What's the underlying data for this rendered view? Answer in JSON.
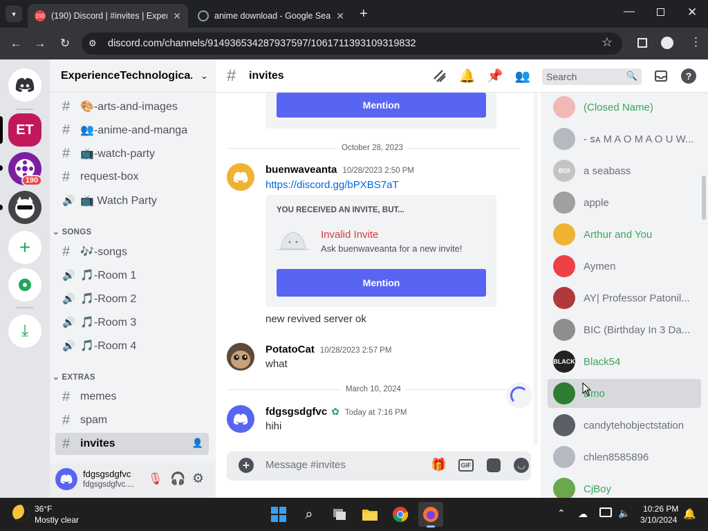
{
  "browser": {
    "tabs": [
      {
        "title": "(190) Discord | #invites | Experie",
        "badge": "190"
      },
      {
        "title": "anime download - Google Sear"
      }
    ],
    "url": "discord.com/channels/914936534287937597/1061711393109319832"
  },
  "server": {
    "name": "ExperienceTechnologica...",
    "guild_badge": "190",
    "et_label": "ET"
  },
  "channels": {
    "top": [
      {
        "prefix": "#",
        "label": "🎨-arts-and-images"
      },
      {
        "prefix": "#",
        "label": "👥-anime-and-manga"
      },
      {
        "prefix": "#",
        "label": "📺-watch-party"
      },
      {
        "prefix": "#",
        "label": "request-box"
      },
      {
        "prefix": "spk",
        "label": "📺 Watch Party"
      }
    ],
    "songs_category": "SONGS",
    "songs": [
      {
        "prefix": "#",
        "label": "🎶-songs"
      },
      {
        "prefix": "spk",
        "label": "🎵-Room 1"
      },
      {
        "prefix": "spk",
        "label": "🎵-Room 2"
      },
      {
        "prefix": "spk",
        "label": "🎵-Room 3"
      },
      {
        "prefix": "spk",
        "label": "🎵-Room 4"
      }
    ],
    "extras_category": "EXTRAS",
    "extras": [
      {
        "prefix": "#",
        "label": "memes"
      },
      {
        "prefix": "#",
        "label": "spam"
      },
      {
        "prefix": "#",
        "label": "invites"
      }
    ]
  },
  "user": {
    "name": "fdgsgsdgfvc",
    "tag": "fdgsgsdgfvc...."
  },
  "header": {
    "channel": "invites",
    "search_placeholder": "Search"
  },
  "chat": {
    "mention_label": "Mention",
    "date1": "October 28, 2023",
    "msg1": {
      "author": "buenwaveanta",
      "time": "10/28/2023 2:50 PM",
      "link": "https://discord.gg/bPXBS7aT"
    },
    "invite": {
      "heading": "YOU RECEIVED AN INVITE, BUT...",
      "title": "Invalid Invite",
      "sub": "Ask buenwaveanta for a new invite!"
    },
    "msg1b": "new revived server ok",
    "msg2": {
      "author": "PotatoCat",
      "time": "10/28/2023 2:57 PM",
      "text": "what"
    },
    "date2": "March 10, 2024",
    "msg3": {
      "author": "fdgsgsdgfvc",
      "time": "Today at 7:16 PM",
      "text": "hihi"
    },
    "composer_placeholder": "Message #invites",
    "gif_label": "GIF"
  },
  "members": [
    {
      "name": "(Closed Name)",
      "color": "#3ba55c",
      "avatar": "#f2b8b8",
      "mark": ""
    },
    {
      "name": "- ꜱᴀ M A O M A O U W...",
      "color": "#6d6f78",
      "avatar": "#b5bac1",
      "mark": ""
    },
    {
      "name": "a seabass",
      "color": "#6d6f78",
      "avatar": "#c4c4c4",
      "mark": "BOI"
    },
    {
      "name": "apple",
      "color": "#6d6f78",
      "avatar": "#a0a0a0",
      "mark": ""
    },
    {
      "name": "Arthur and You",
      "color": "#3ba55c",
      "avatar": "#f0b232",
      "mark": ""
    },
    {
      "name": "Aymen",
      "color": "#6d6f78",
      "avatar": "#ed4245",
      "mark": ""
    },
    {
      "name": "AY| Professor Patonil...",
      "color": "#6d6f78",
      "avatar": "#b03a3a",
      "mark": ""
    },
    {
      "name": "BIC (Birthday In 3 Da...",
      "color": "#6d6f78",
      "avatar": "#8e8e8e",
      "mark": ""
    },
    {
      "name": "Black54",
      "color": "#3ba55c",
      "avatar": "#222222",
      "mark": "BLACK"
    },
    {
      "name": "Bmo",
      "color": "#3ba55c",
      "avatar": "#2e7d32",
      "mark": ""
    },
    {
      "name": "candytehobjectstation",
      "color": "#6d6f78",
      "avatar": "#5c5e66",
      "mark": ""
    },
    {
      "name": "chlen8585896",
      "color": "#6d6f78",
      "avatar": "#b5bac1",
      "mark": ""
    },
    {
      "name": "CjBoy",
      "color": "#3ba55c",
      "avatar": "#6aa84f",
      "mark": ""
    }
  ],
  "taskbar": {
    "temp": "36°F",
    "weather": "Mostly clear",
    "time": "10:26 PM",
    "date": "3/10/2024"
  }
}
